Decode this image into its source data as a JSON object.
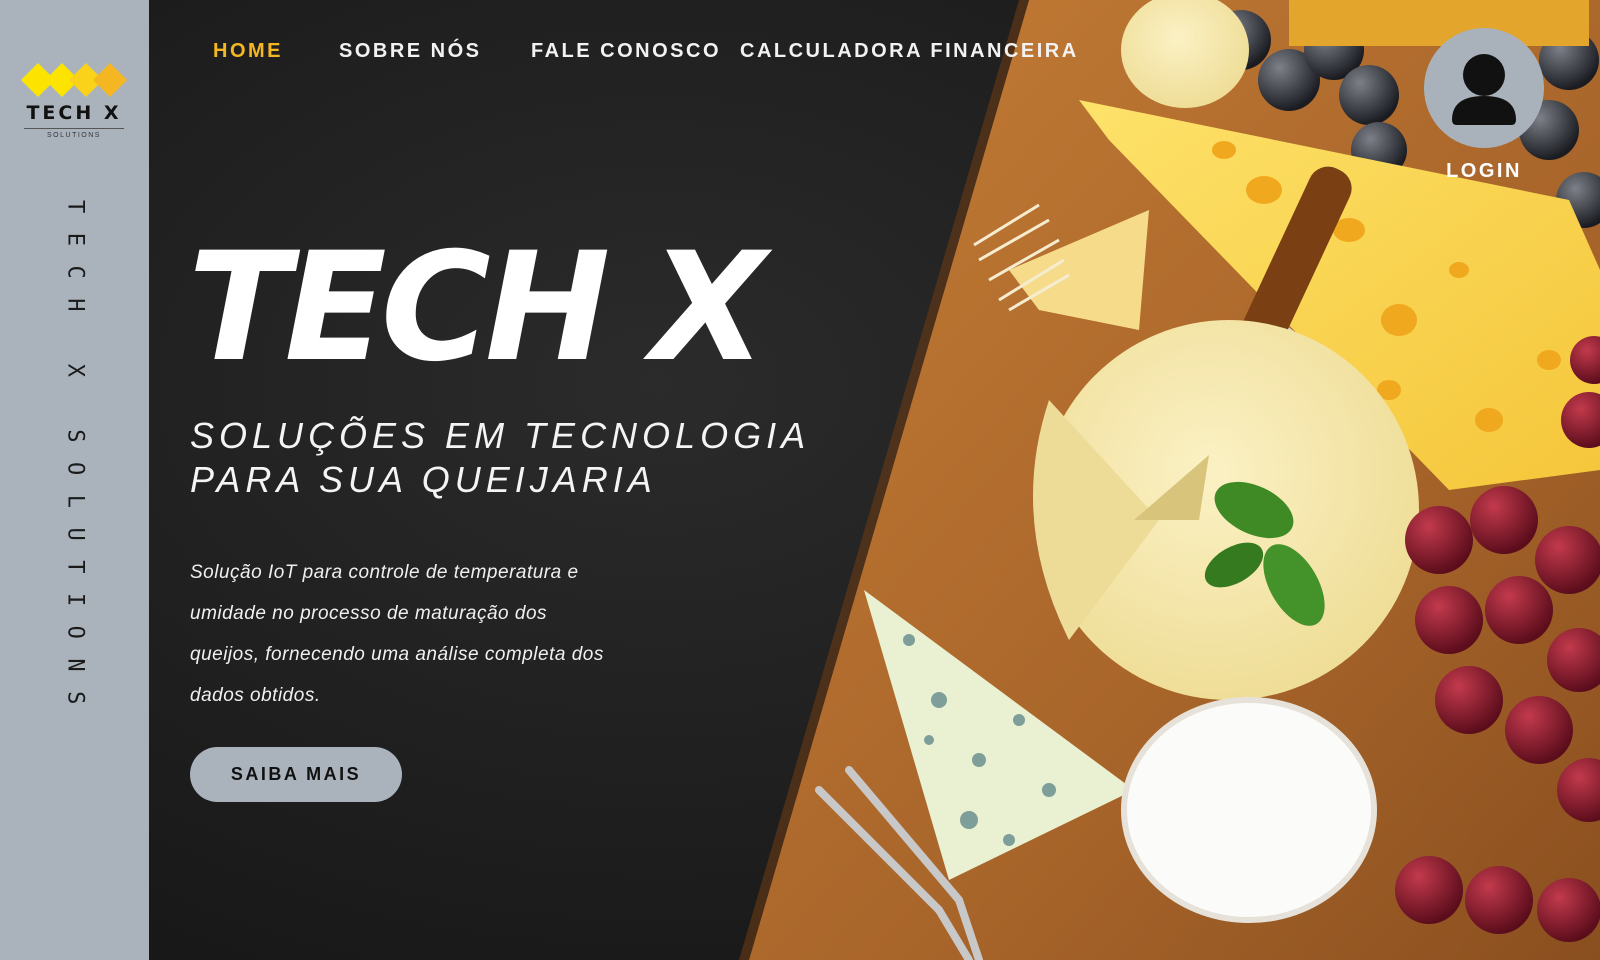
{
  "brand": {
    "name": "TECH X",
    "tagline": "SOLUTIONS",
    "vertical": "TECH X SOLUTIONS",
    "diamond_color": "#fde400",
    "diamond_accent": "#f5b721"
  },
  "nav": {
    "items": [
      {
        "label": "HOME",
        "active": true
      },
      {
        "label": "SOBRE NÓS",
        "active": false
      },
      {
        "label": "FALE CONOSCO",
        "active": false
      },
      {
        "label": "CALCULADORA FINANCEIRA",
        "active": false
      }
    ],
    "active_color": "#f5b721"
  },
  "login": {
    "label": "LOGIN",
    "icon": "user-icon"
  },
  "hero": {
    "title": "TECH X",
    "subtitle_line1": "SOLUÇÕES EM TECNOLOGIA",
    "subtitle_line2": "PARA SUA QUEIJARIA",
    "description": "Solução IoT para controle de temperatura e umidade no processo de maturação dos queijos, fornecendo uma análise completa dos dados obtidos.",
    "cta_label": "SAIBA MAIS",
    "background_image": "cheese-board-image"
  },
  "colors": {
    "sidebar": "#aab3bc",
    "dark_bg": "#232323",
    "board": "#b5702f"
  }
}
